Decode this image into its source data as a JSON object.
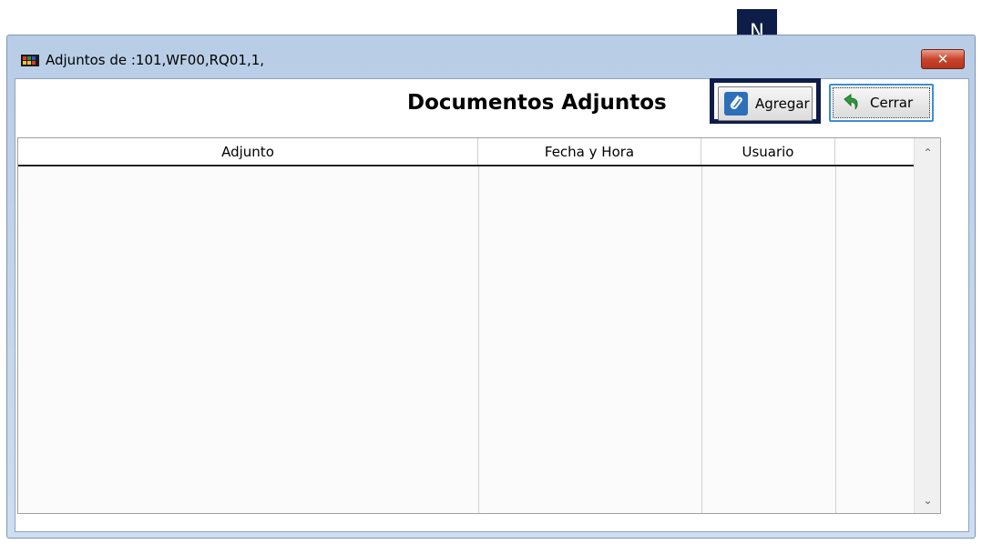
{
  "callout": {
    "label": "N"
  },
  "window": {
    "title": "Adjuntos de :101,WF00,RQ01,1,",
    "close_label": "✕"
  },
  "heading": "Documentos Adjuntos",
  "toolbar": {
    "agregar_label": "Agregar",
    "cerrar_label": "Cerrar"
  },
  "grid": {
    "columns": [
      "Adjunto",
      "Fecha y Hora",
      "Usuario",
      ""
    ],
    "rows": []
  },
  "scrollbar": {
    "up": "⌃",
    "down": "⌄"
  },
  "colors": {
    "callout": "#0e1d47",
    "accent_border": "#3a8fd6"
  }
}
